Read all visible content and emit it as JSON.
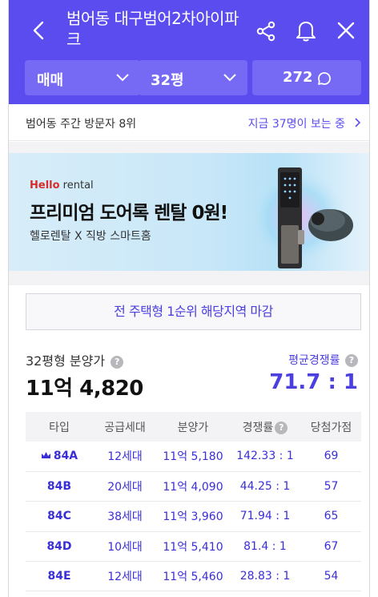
{
  "header": {
    "title": "범어동 대구범어2차아이파크",
    "trade_type": "매매",
    "size": "32평",
    "comment_count": "272"
  },
  "visitors": {
    "rank_text": "범어동 주간 방문자 8위",
    "now_text": "지금 37명이 보는 중"
  },
  "banner": {
    "brand_hello": "Hello",
    "brand_rental": " rental",
    "title": "프리미엄 도어록 렌탈 0원!",
    "subtitle": "헬로렌탈 X 직방 스마트홈"
  },
  "notice": "전 주택형 1순위 해당지역 마감",
  "price": {
    "label": "32평형 분양가",
    "value": "11억 4,820"
  },
  "competition": {
    "label": "평균경쟁률",
    "value": "71.7 : 1"
  },
  "table": {
    "headers": [
      "타입",
      "공급세대",
      "분양가",
      "경쟁률",
      "당첨가점"
    ],
    "rows": [
      {
        "type": "84A",
        "units": "12세대",
        "price": "11억 5,180",
        "rate": "142.33 : 1",
        "score": "69"
      },
      {
        "type": "84B",
        "units": "20세대",
        "price": "11억 4,090",
        "rate": "44.25 : 1",
        "score": "57"
      },
      {
        "type": "84C",
        "units": "38세대",
        "price": "11억 3,960",
        "rate": "71.94 : 1",
        "score": "65"
      },
      {
        "type": "84D",
        "units": "10세대",
        "price": "11억 5,410",
        "rate": "81.4 : 1",
        "score": "67"
      },
      {
        "type": "84E",
        "units": "12세대",
        "price": "11억 5,460",
        "rate": "28.83 : 1",
        "score": "54"
      }
    ]
  },
  "colors": {
    "brand": "#5b4cf0",
    "accent_text": "#4b3fe0"
  },
  "icons": [
    "back-icon",
    "share-icon",
    "bell-icon",
    "close-icon",
    "chevron-down-icon",
    "chat-bubble-icon",
    "chevron-right-icon",
    "help-icon",
    "crown-icon"
  ]
}
